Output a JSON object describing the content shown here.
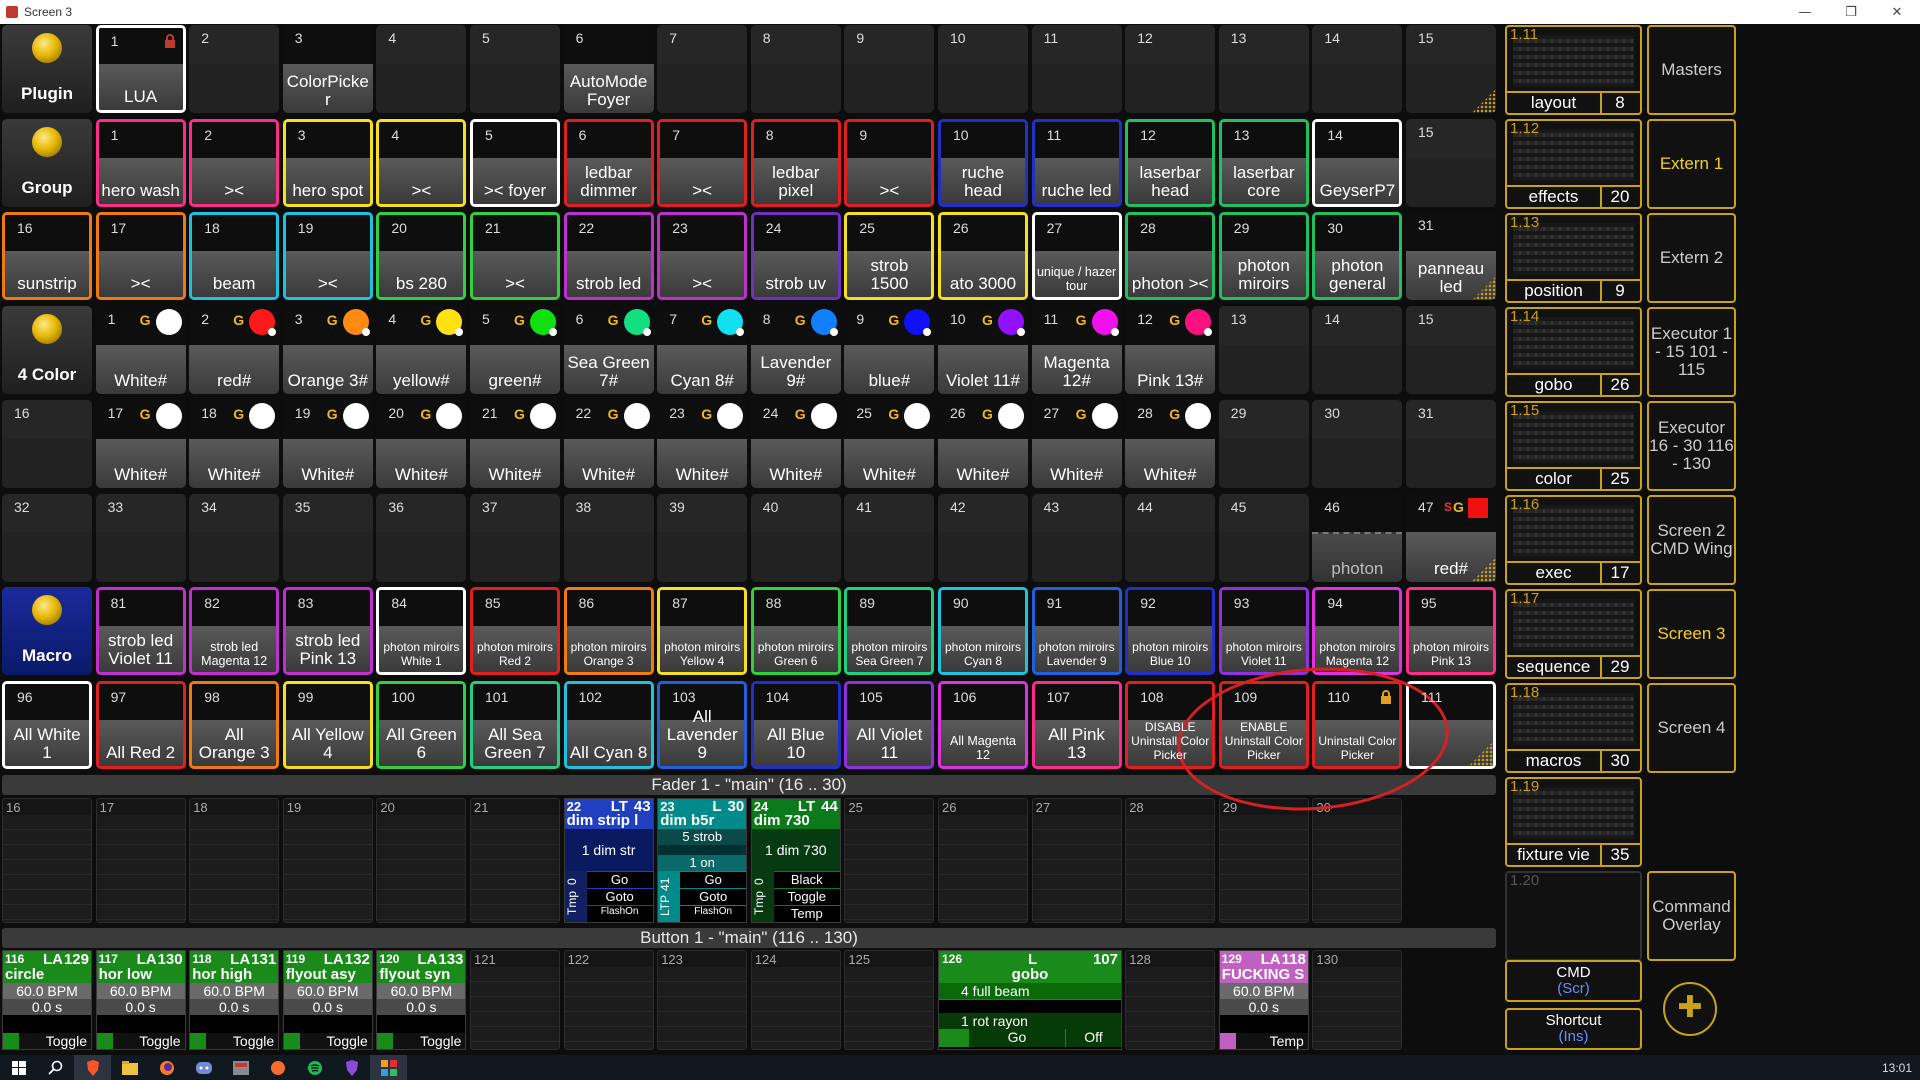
{
  "window": {
    "title": "Screen 3"
  },
  "heads": [
    {
      "row": 0,
      "label": "Plugin"
    },
    {
      "row": 1,
      "label": "Group"
    },
    {
      "row": 3,
      "label": "4 Color"
    },
    {
      "row": 6,
      "label": "Macro"
    }
  ],
  "rows": [
    [
      {
        "n": "1",
        "l": "LUA",
        "lock": true,
        "c": "#ffffff"
      },
      {
        "n": "2",
        "l": ""
      },
      {
        "n": "3",
        "l": "ColorPicke r"
      },
      {
        "n": "4",
        "l": ""
      },
      {
        "n": "5",
        "l": ""
      },
      {
        "n": "6",
        "l": "AutoMode Foyer"
      },
      {
        "n": "7",
        "l": ""
      },
      {
        "n": "8",
        "l": ""
      },
      {
        "n": "9",
        "l": ""
      },
      {
        "n": "10",
        "l": ""
      },
      {
        "n": "11",
        "l": ""
      },
      {
        "n": "12",
        "l": ""
      },
      {
        "n": "13",
        "l": ""
      },
      {
        "n": "14",
        "l": ""
      },
      {
        "n": "15",
        "l": "",
        "corner": true
      }
    ],
    [
      {
        "n": "1",
        "l": "hero wash",
        "c": "#ff2d8a"
      },
      {
        "n": "2",
        "l": "><",
        "c": "#ff2d8a"
      },
      {
        "n": "3",
        "l": "hero spot",
        "c": "#f5e020"
      },
      {
        "n": "4",
        "l": "><",
        "c": "#f5e020"
      },
      {
        "n": "5",
        "l": ">< foyer",
        "c": "#ffffff"
      },
      {
        "n": "6",
        "l": "ledbar dimmer",
        "c": "#e01f1f"
      },
      {
        "n": "7",
        "l": "><",
        "c": "#e01f1f"
      },
      {
        "n": "8",
        "l": "ledbar pixel",
        "c": "#e01f1f"
      },
      {
        "n": "9",
        "l": "><",
        "c": "#e01f1f"
      },
      {
        "n": "10",
        "l": "ruche head",
        "c": "#2030c8"
      },
      {
        "n": "11",
        "l": "ruche led",
        "c": "#2030c8"
      },
      {
        "n": "12",
        "l": "laserbar head",
        "c": "#20c060"
      },
      {
        "n": "13",
        "l": "laserbar core",
        "c": "#20c060"
      },
      {
        "n": "14",
        "l": "GeyserP7",
        "c": "#ffffff"
      },
      {
        "n": "15",
        "l": ""
      }
    ],
    [
      {
        "n": "16",
        "l": "sunstrip",
        "c": "#f07a10"
      },
      {
        "n": "17",
        "l": "><",
        "c": "#f07a10"
      },
      {
        "n": "18",
        "l": "beam",
        "c": "#20c0e0"
      },
      {
        "n": "19",
        "l": "><",
        "c": "#20c0e0"
      },
      {
        "n": "20",
        "l": "bs 280",
        "c": "#30d040"
      },
      {
        "n": "21",
        "l": "><",
        "c": "#30d040"
      },
      {
        "n": "22",
        "l": "strob led",
        "c": "#c030d0"
      },
      {
        "n": "23",
        "l": "><",
        "c": "#c030d0"
      },
      {
        "n": "24",
        "l": "strob uv",
        "c": "#7030c0"
      },
      {
        "n": "25",
        "l": "strob 1500",
        "c": "#f5e020"
      },
      {
        "n": "26",
        "l": "ato 3000",
        "c": "#f5e020"
      },
      {
        "n": "27",
        "l": "unique / hazer tour",
        "c": "#ffffff",
        "s": true
      },
      {
        "n": "28",
        "l": "photon ><",
        "c": "#20c060"
      },
      {
        "n": "29",
        "l": "photon miroirs",
        "c": "#20c060"
      },
      {
        "n": "30",
        "l": "photon general",
        "c": "#20c060"
      },
      {
        "n": "31",
        "l": "panneau led",
        "c": "#222222",
        "corner": true
      }
    ],
    [
      {
        "n": "1",
        "l": "White#",
        "dot": "#ffffff"
      },
      {
        "n": "2",
        "l": "red#",
        "dot": "#ff1a1a"
      },
      {
        "n": "3",
        "l": "Orange 3#",
        "dot": "#ff8a10"
      },
      {
        "n": "4",
        "l": "yellow#",
        "dot": "#ffe010"
      },
      {
        "n": "5",
        "l": "green#",
        "dot": "#10e010"
      },
      {
        "n": "6",
        "l": "Sea Green 7#",
        "dot": "#10e080"
      },
      {
        "n": "7",
        "l": "Cyan 8#",
        "dot": "#10e0f0"
      },
      {
        "n": "8",
        "l": "Lavender 9#",
        "dot": "#1080ff"
      },
      {
        "n": "9",
        "l": "blue#",
        "dot": "#1010ff"
      },
      {
        "n": "10",
        "l": "Violet 11#",
        "dot": "#9010ff"
      },
      {
        "n": "11",
        "l": "Magenta 12#",
        "dot": "#f010f0"
      },
      {
        "n": "12",
        "l": "Pink 13#",
        "dot": "#ff1080"
      },
      {
        "n": "13",
        "l": ""
      },
      {
        "n": "14",
        "l": ""
      },
      {
        "n": "15",
        "l": ""
      }
    ],
    [
      {
        "n": "16",
        "l": ""
      },
      {
        "n": "17",
        "l": "White#",
        "dot": "#ffffff"
      },
      {
        "n": "18",
        "l": "White#",
        "dot": "#ffffff"
      },
      {
        "n": "19",
        "l": "White#",
        "dot": "#ffffff"
      },
      {
        "n": "20",
        "l": "White#",
        "dot": "#ffffff"
      },
      {
        "n": "21",
        "l": "White#",
        "dot": "#ffffff"
      },
      {
        "n": "22",
        "l": "White#",
        "dot": "#ffffff"
      },
      {
        "n": "23",
        "l": "White#",
        "dot": "#ffffff"
      },
      {
        "n": "24",
        "l": "White#",
        "dot": "#ffffff"
      },
      {
        "n": "25",
        "l": "White#",
        "dot": "#ffffff"
      },
      {
        "n": "26",
        "l": "White#",
        "dot": "#ffffff"
      },
      {
        "n": "27",
        "l": "White#",
        "dot": "#ffffff"
      },
      {
        "n": "28",
        "l": "White#",
        "dot": "#ffffff"
      },
      {
        "n": "29",
        "l": ""
      },
      {
        "n": "30",
        "l": ""
      },
      {
        "n": "31",
        "l": ""
      }
    ],
    [
      {
        "n": "32",
        "l": ""
      },
      {
        "n": "33",
        "l": ""
      },
      {
        "n": "34",
        "l": ""
      },
      {
        "n": "35",
        "l": ""
      },
      {
        "n": "36",
        "l": ""
      },
      {
        "n": "37",
        "l": ""
      },
      {
        "n": "38",
        "l": ""
      },
      {
        "n": "39",
        "l": ""
      },
      {
        "n": "40",
        "l": ""
      },
      {
        "n": "41",
        "l": ""
      },
      {
        "n": "42",
        "l": ""
      },
      {
        "n": "43",
        "l": ""
      },
      {
        "n": "44",
        "l": ""
      },
      {
        "n": "45",
        "l": ""
      },
      {
        "n": "46",
        "l": "photon",
        "dim": true
      },
      {
        "n": "47",
        "l": "red#",
        "redsq": true,
        "corner": true
      }
    ],
    [
      {
        "n": "81",
        "l": "strob led Violet 11",
        "c": "#c030d0"
      },
      {
        "n": "82",
        "l": "strob led Magenta 12",
        "c": "#c030d0",
        "s": true
      },
      {
        "n": "83",
        "l": "strob led Pink 13",
        "c": "#c030d0"
      },
      {
        "n": "84",
        "l": "photon miroirs White 1",
        "c": "#ffffff",
        "xs": true
      },
      {
        "n": "85",
        "l": "photon miroirs Red 2",
        "c": "#e01f1f",
        "xs": true
      },
      {
        "n": "86",
        "l": "photon miroirs Orange 3",
        "c": "#f07a10",
        "xs": true
      },
      {
        "n": "87",
        "l": "photon miroirs Yellow 4",
        "c": "#f5e020",
        "xs": true
      },
      {
        "n": "88",
        "l": "photon miroirs Green 6",
        "c": "#30d040",
        "xs": true
      },
      {
        "n": "89",
        "l": "photon miroirs Sea Green 7",
        "c": "#20d080",
        "xs": true
      },
      {
        "n": "90",
        "l": "photon miroirs Cyan 8",
        "c": "#20c0e0",
        "xs": true
      },
      {
        "n": "91",
        "l": "photon miroirs Lavender 9",
        "c": "#2060e0",
        "xs": true
      },
      {
        "n": "92",
        "l": "photon miroirs Blue 10",
        "c": "#2030c8",
        "xs": true
      },
      {
        "n": "93",
        "l": "photon miroirs Violet 11",
        "c": "#9030e0",
        "xs": true
      },
      {
        "n": "94",
        "l": "photon miroirs Magenta 12",
        "c": "#e030e0",
        "xs": true
      },
      {
        "n": "95",
        "l": "photon miroirs Pink 13",
        "c": "#ff2d8a",
        "xs": true
      }
    ],
    [
      {
        "n": "96",
        "l": "All White 1",
        "c": "#ffffff"
      },
      {
        "n": "97",
        "l": "All Red 2",
        "c": "#e01f1f"
      },
      {
        "n": "98",
        "l": "All Orange 3",
        "c": "#f07a10"
      },
      {
        "n": "99",
        "l": "All Yellow 4",
        "c": "#f5e020"
      },
      {
        "n": "100",
        "l": "All Green 6",
        "c": "#30d040"
      },
      {
        "n": "101",
        "l": "All Sea Green 7",
        "c": "#20d080"
      },
      {
        "n": "102",
        "l": "All Cyan 8",
        "c": "#20c0e0"
      },
      {
        "n": "103",
        "l": "All Lavender 9",
        "c": "#2060e0"
      },
      {
        "n": "104",
        "l": "All Blue 10",
        "c": "#2030c8"
      },
      {
        "n": "105",
        "l": "All Violet 11",
        "c": "#9030e0"
      },
      {
        "n": "106",
        "l": "All Magenta 12",
        "c": "#e030e0",
        "s": true
      },
      {
        "n": "107",
        "l": "All Pink 13",
        "c": "#ff2d8a"
      },
      {
        "n": "108",
        "l": "DISABLE Uninstall Color Picker",
        "c": "#e01f1f",
        "xs": true
      },
      {
        "n": "109",
        "l": "ENABLE Uninstall Color Picker",
        "c": "#e01f1f",
        "xs": true
      },
      {
        "n": "110",
        "l": "Uninstall Color Picker",
        "c": "#e01f1f",
        "xs": true,
        "lock": true
      },
      {
        "n": "111",
        "l": "",
        "c": "#ffffff",
        "corner": true
      }
    ]
  ],
  "fader": {
    "title": "Fader  1  - \"main\" (16 .. 30)",
    "cells": [
      "16",
      "17",
      "18",
      "19",
      "20",
      "21",
      "",
      "",
      "",
      "25",
      "26",
      "27",
      "28",
      "29",
      "30"
    ],
    "ex22": {
      "num": "22",
      "kind": "LT",
      "val": "43",
      "name": "dim strip l",
      "cue": "1 dim str",
      "mode": "Tmp",
      "mval": "0",
      "a": "Go",
      "b": "Goto",
      "c": "FlashOn"
    },
    "ex23": {
      "num": "23",
      "kind": "L",
      "val": "30",
      "name": "dim b5r",
      "cue1": "5 strob",
      "cue2": "1 on",
      "mode": "LTP",
      "mval": "41",
      "a": "Go",
      "b": "Goto",
      "c": "FlashOn"
    },
    "ex24": {
      "num": "24",
      "kind": "LT",
      "val": "44",
      "name": "dim 730",
      "cue": "1 dim 730",
      "mode": "Tmp",
      "mval": "0",
      "a": "Black",
      "b": "Toggle",
      "c": "Temp"
    }
  },
  "button": {
    "title": "Button  1  - \"main\" (116 .. 130)",
    "execs": [
      {
        "num": "116",
        "kind": "LA",
        "val": "129",
        "name": "circle",
        "bpm": "60.0 BPM",
        "time": "0.0 s",
        "foot": "Toggle"
      },
      {
        "num": "117",
        "kind": "LA",
        "val": "130",
        "name": "hor low",
        "bpm": "60.0 BPM",
        "time": "0.0 s",
        "foot": "Toggle"
      },
      {
        "num": "118",
        "kind": "LA",
        "val": "131",
        "name": "hor high",
        "bpm": "60.0 BPM",
        "time": "0.0 s",
        "foot": "Toggle"
      },
      {
        "num": "119",
        "kind": "LA",
        "val": "132",
        "name": "flyout asy",
        "bpm": "60.0 BPM",
        "time": "0.0 s",
        "foot": "Toggle"
      },
      {
        "num": "120",
        "kind": "LA",
        "val": "133",
        "name": "flyout syn",
        "bpm": "60.0 BPM",
        "time": "0.0 s",
        "foot": "Toggle"
      }
    ],
    "empties": [
      "121",
      "122",
      "123",
      "124",
      "125",
      "128",
      "130"
    ],
    "ex126": {
      "num": "126",
      "kind": "L",
      "val": "107",
      "name": "gobo",
      "cue1": "4 full beam",
      "cue2": "1 rot rayon",
      "a": "Go",
      "b": "Off"
    },
    "ex129": {
      "num": "129",
      "kind": "LA",
      "val": "118",
      "name": "FUCKING S",
      "bpm": "60.0 BPM",
      "time": "0.0 s",
      "foot": "Temp"
    }
  },
  "views": [
    {
      "n": "1.11",
      "l": "layout",
      "c": "8"
    },
    {
      "n": "1.12",
      "l": "effects",
      "c": "20"
    },
    {
      "n": "1.13",
      "l": "position",
      "c": "9"
    },
    {
      "n": "1.14",
      "l": "gobo",
      "c": "26"
    },
    {
      "n": "1.15",
      "l": "color",
      "c": "25"
    },
    {
      "n": "1.16",
      "l": "exec",
      "c": "17"
    },
    {
      "n": "1.17",
      "l": "sequence",
      "c": "29"
    },
    {
      "n": "1.18",
      "l": "macros",
      "c": "30"
    },
    {
      "n": "1.19",
      "l": "fixture vie",
      "c": "35"
    },
    {
      "n": "1.20",
      "l": "",
      "c": ""
    }
  ],
  "right": [
    {
      "l": "Masters"
    },
    {
      "l": "Extern 1",
      "act": true
    },
    {
      "l": "Extern 2"
    },
    {
      "l": "Executor 1 - 15 101 - 115"
    },
    {
      "l": "Executor 16 - 30 116 - 130"
    },
    {
      "l": "Screen 2 CMD Wing"
    },
    {
      "l": "Screen 3",
      "act": true
    },
    {
      "l": "Screen 4"
    },
    {
      "l": ""
    },
    {
      "l": "Command Overlay"
    }
  ],
  "cmd": {
    "label": "CMD",
    "sub": "(Scr)"
  },
  "shortcut": {
    "label": "Shortcut",
    "sub": "(Ins)"
  },
  "taskbar": {
    "clock": "13:01"
  }
}
